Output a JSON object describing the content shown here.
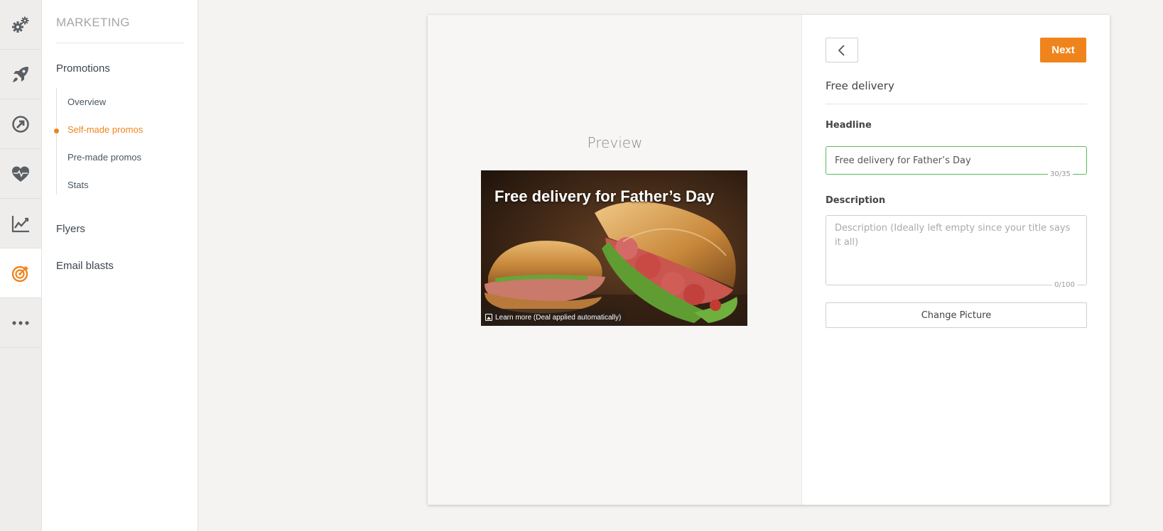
{
  "colors": {
    "accent": "#f0841c",
    "valid_border": "#5cb85c",
    "rail_icon": "#5a5f64"
  },
  "rail": {
    "items": [
      {
        "icon": "gears-icon",
        "active": false
      },
      {
        "icon": "rocket-icon",
        "active": false
      },
      {
        "icon": "circle-arrow-icon",
        "active": false
      },
      {
        "icon": "heart-pulse-icon",
        "active": false
      },
      {
        "icon": "line-chart-icon",
        "active": false
      },
      {
        "icon": "target-icon",
        "active": true
      },
      {
        "icon": "more-icon",
        "active": false
      }
    ]
  },
  "subnav": {
    "title": "MARKETING",
    "promotions": "Promotions",
    "sub_items": [
      "Overview",
      "Self-made promos",
      "Pre-made promos",
      "Stats"
    ],
    "active_sub": "Self-made promos",
    "flyers": "Flyers",
    "email_blasts": "Email blasts"
  },
  "preview": {
    "label": "Preview",
    "headline": "Free delivery for Father’s Day",
    "cta": "Learn more (Deal applied automatically)"
  },
  "form": {
    "next_label": "Next",
    "title": "Free delivery",
    "headline_label": "Headline",
    "headline_value": "Free delivery for Father’s Day",
    "headline_counter": "30/35",
    "description_label": "Description",
    "description_placeholder": "Description (Ideally left empty since your title says it all)",
    "description_value": "",
    "description_counter": "0/100",
    "change_picture_label": "Change Picture"
  }
}
